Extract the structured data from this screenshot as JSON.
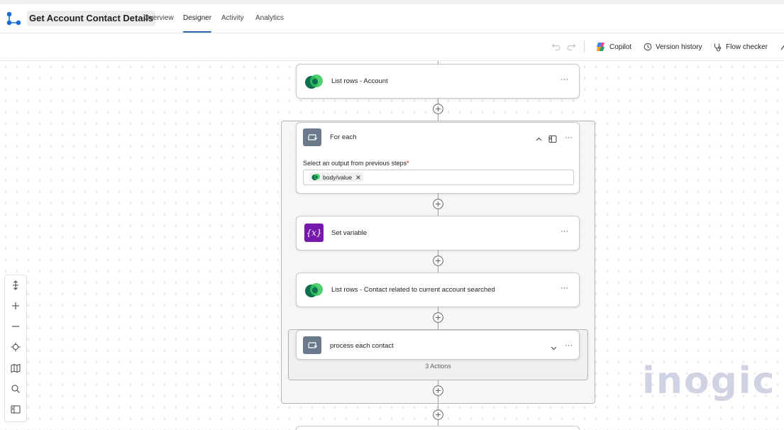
{
  "header": {
    "title": "Get Account Contact Details",
    "tabs": [
      {
        "label": "Overview"
      },
      {
        "label": "Designer"
      },
      {
        "label": "Activity"
      },
      {
        "label": "Analytics"
      }
    ]
  },
  "toolbar": {
    "copilot_label": "Copilot",
    "version_history_label": "Version history",
    "flow_checker_label": "Flow checker"
  },
  "flow": {
    "list_rows_account": "List rows - Account",
    "for_each": {
      "title": "For each",
      "field_label": "Select an output from previous steps",
      "required_mark": "*",
      "token": "body/value"
    },
    "set_variable": "Set variable",
    "set_variable_icon": "{x}",
    "list_rows_contact": "List rows - Contact related to current account searched",
    "process_each_contact": {
      "title": "process each contact",
      "actions_count": "3 Actions"
    },
    "more_label": "···"
  },
  "watermark": "inogic",
  "colors": {
    "accent": "#2b6cb0",
    "dataverse_green": "#0f7b4f",
    "loop_gray": "#6b7a8a",
    "variable_purple": "#7719aa"
  }
}
